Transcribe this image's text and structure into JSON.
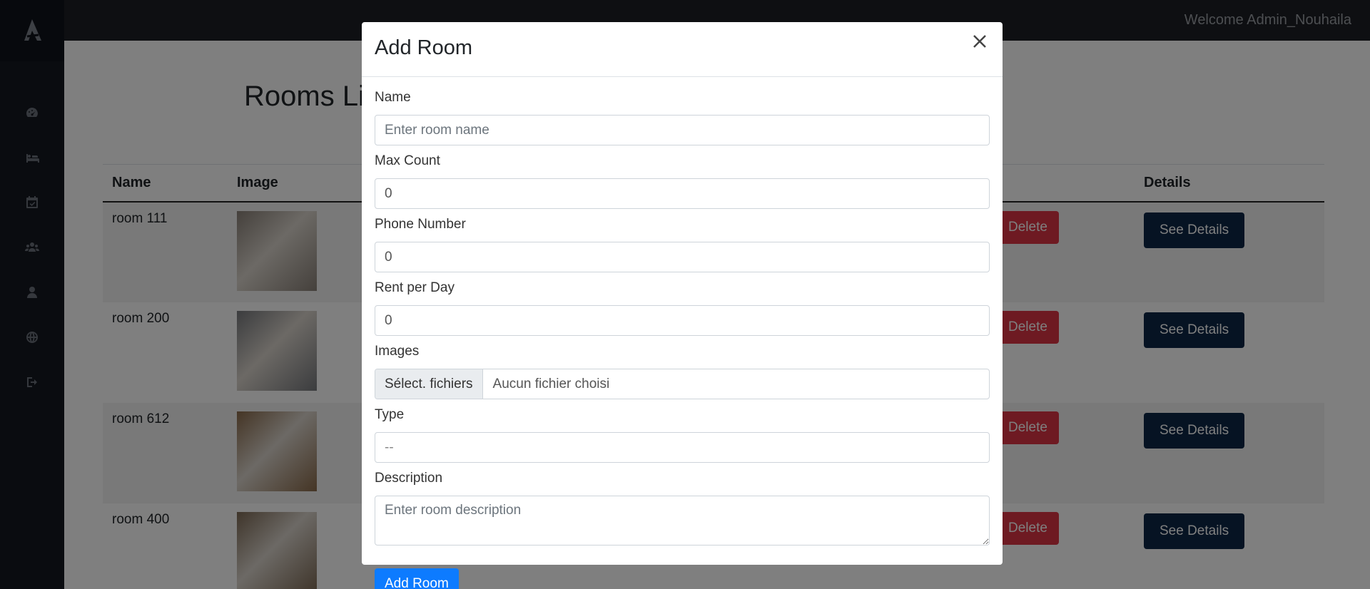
{
  "topbar": {
    "welcome": "Welcome Admin_Nouhaila"
  },
  "sidebar": {
    "items": [
      {
        "icon": "dashboard-icon"
      },
      {
        "icon": "bed-icon"
      },
      {
        "icon": "calendar-icon"
      },
      {
        "icon": "users-icon"
      },
      {
        "icon": "user-icon"
      },
      {
        "icon": "globe-icon"
      },
      {
        "icon": "logout-icon"
      }
    ]
  },
  "page": {
    "title": "Rooms Li",
    "table": {
      "headers": {
        "name": "Name",
        "image": "Image",
        "details": "Details"
      },
      "rows": [
        {
          "name": "room 111",
          "delete": "Delete",
          "details": "See Details",
          "img_color": "#8a8178"
        },
        {
          "name": "room 200",
          "delete": "Delete",
          "details": "See Details",
          "img_color": "#77797d"
        },
        {
          "name": "room 612",
          "delete": "Delete",
          "details": "See Details",
          "img_color": "#8a6a4a"
        },
        {
          "name": "room 400",
          "delete": "Delete",
          "details": "See Details",
          "img_color": "#7e6a55"
        }
      ]
    }
  },
  "modal": {
    "title": "Add Room",
    "fields": {
      "name": {
        "label": "Name",
        "placeholder": "Enter room name"
      },
      "max_count": {
        "label": "Max Count",
        "value": "0"
      },
      "phone": {
        "label": "Phone Number",
        "value": "0"
      },
      "rent": {
        "label": "Rent per Day",
        "value": "0"
      },
      "images": {
        "label": "Images",
        "button": "Sélect. fichiers",
        "status": "Aucun fichier choisi"
      },
      "type": {
        "label": "Type",
        "value": "--"
      },
      "description": {
        "label": "Description",
        "placeholder": "Enter room description"
      }
    },
    "submit": "Add Room"
  },
  "colors": {
    "sidebar": "#141820",
    "topbar": "#1d1f24",
    "primary": "#0d7bff",
    "delete": "#dc3545",
    "details": "#0c2746"
  }
}
